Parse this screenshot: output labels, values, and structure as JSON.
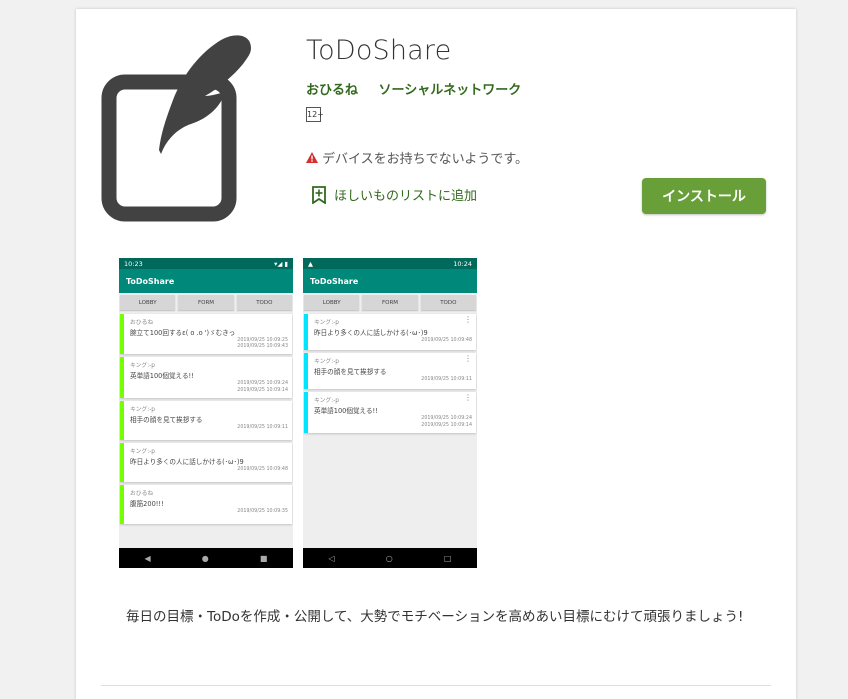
{
  "app": {
    "title": "ToDoShare",
    "developer": "おひるね",
    "category": "ソーシャルネットワーク",
    "content_rating": "12+",
    "warning": "デバイスをお持ちでないようです。",
    "wishlist_label": "ほしいものリストに追加",
    "install_label": "インストール",
    "description": "毎日の目標・ToDoを作成・公開して、大勢でモチベーションを高めあい目標にむけて頑張りましょう!"
  },
  "icons": {
    "app_icon": "pen-on-note-icon",
    "warning": "warning-triangle-icon",
    "wishlist": "bookmark-plus-icon"
  },
  "colors": {
    "accent_green": "#689f38",
    "text_green": "#33691e",
    "app_teal_dark": "#00695c",
    "app_teal": "#00897b",
    "item_left_green": "#76ff03",
    "item_left_cyan": "#00e5ff"
  },
  "screenshot1": {
    "status_time": "10:23",
    "status_right": "▾◢ ▮",
    "app_title": "ToDoShare",
    "tabs": [
      "LOBBY",
      "FORM",
      "TODO"
    ],
    "items": [
      {
        "user": "おひるね",
        "msg": "腕立て100回するε( o .o ')ゞむきっ",
        "dates": [
          "2019/09/25 10:09:25",
          "2019/09/25 10:09:43"
        ]
      },
      {
        "user": "キング:-p",
        "msg": "英単語100個覚える!!",
        "dates": [
          "2019/09/25 10:09:24",
          "2019/09/25 10:09:14"
        ]
      },
      {
        "user": "キング:-p",
        "msg": "相手の顔を見て挨拶する",
        "dates": [
          "2019/09/25 10:09:11"
        ]
      },
      {
        "user": "キング:-p",
        "msg": "昨日より多くの人に話しかける(･ω･)9",
        "dates": [
          "2019/09/25 10:09:48"
        ]
      },
      {
        "user": "おひるね",
        "msg": "腹筋200!!!",
        "dates": [
          "2019/09/25 10:09:35"
        ]
      }
    ]
  },
  "screenshot2": {
    "status_time": "10:24",
    "status_left": "▲",
    "app_title": "ToDoShare",
    "tabs": [
      "LOBBY",
      "FORM",
      "TODO"
    ],
    "items": [
      {
        "user": "キング:-p",
        "msg": "昨日より多くの人に話しかける(･ω･)9",
        "dates": [
          "2019/09/25 10:09:48"
        ]
      },
      {
        "user": "キング:-p",
        "msg": "相手の顔を見て挨拶する",
        "dates": [
          "2019/09/25 10:09:11"
        ]
      },
      {
        "user": "キング:-p",
        "msg": "英単語100個覚える!!",
        "dates": [
          "2019/09/25 10:09:24",
          "2019/09/25 10:09:14"
        ]
      }
    ]
  }
}
